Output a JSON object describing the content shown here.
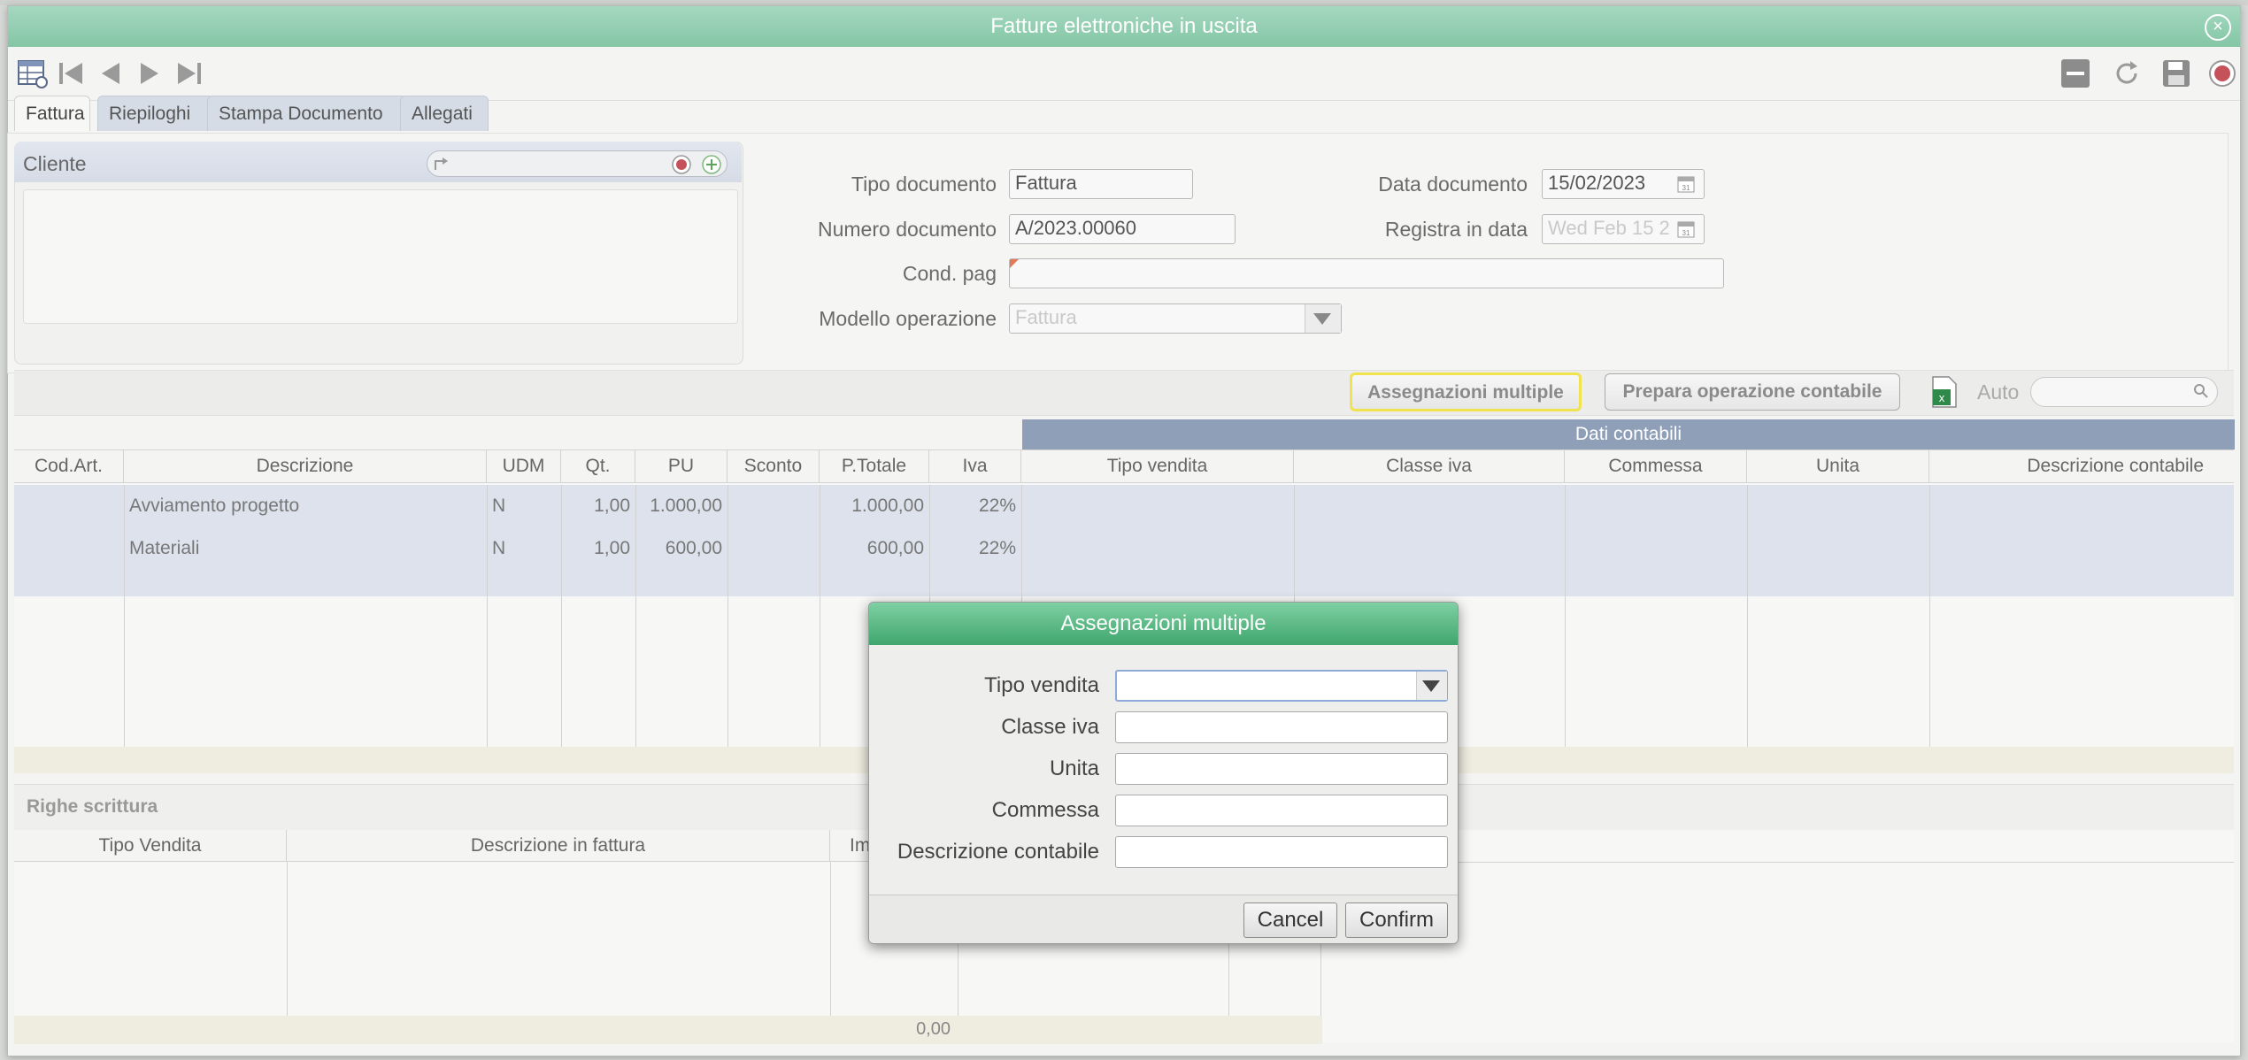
{
  "window": {
    "title": "Fatture elettroniche in uscita"
  },
  "tabs": [
    "Fattura",
    "Riepiloghi",
    "Stampa Documento",
    "Allegati"
  ],
  "cliente": {
    "label": "Cliente"
  },
  "form": {
    "tipo_documento": {
      "label": "Tipo documento",
      "value": "Fattura"
    },
    "numero_documento": {
      "label": "Numero documento",
      "value": "A/2023.00060"
    },
    "cond_pag": {
      "label": "Cond. pag",
      "value": ""
    },
    "modello_operazione": {
      "label": "Modello operazione",
      "value": "Fattura"
    },
    "data_documento": {
      "label": "Data documento",
      "value": "15/02/2023"
    },
    "registra_in_data": {
      "label": "Registra in data",
      "value": "Wed Feb 15 2"
    }
  },
  "actions": {
    "assegnazioni": "Assegnazioni multiple",
    "prepara": "Prepara operazione contabile",
    "auto_label": "Auto",
    "auto_search_placeholder": ""
  },
  "grid": {
    "group_header": "Dati contabili",
    "columns": [
      "Cod.Art.",
      "Descrizione",
      "UDM",
      "Qt.",
      "PU",
      "Sconto",
      "P.Totale",
      "Iva",
      "Tipo vendita",
      "Classe iva",
      "Commessa",
      "Unita",
      "Descrizione contabile"
    ],
    "rows": [
      {
        "cod": "",
        "descrizione": "Avviamento progetto",
        "udm": "N",
        "qt": "1,00",
        "pu": "1.000,00",
        "sconto": "",
        "totale": "1.000,00",
        "iva": "22%"
      },
      {
        "cod": "",
        "descrizione": "Materiali",
        "udm": "N",
        "qt": "1,00",
        "pu": "600,00",
        "sconto": "",
        "totale": "600,00",
        "iva": "22%"
      }
    ]
  },
  "righe": {
    "title": "Righe scrittura",
    "columns": [
      "Tipo Vendita",
      "Descrizione in fattura",
      "Im"
    ],
    "footer_total": "0,00"
  },
  "dialog": {
    "title": "Assegnazioni multiple",
    "fields": [
      "Tipo vendita",
      "Classe iva",
      "Unita",
      "Commessa",
      "Descrizione contabile"
    ],
    "cancel": "Cancel",
    "confirm": "Confirm"
  }
}
